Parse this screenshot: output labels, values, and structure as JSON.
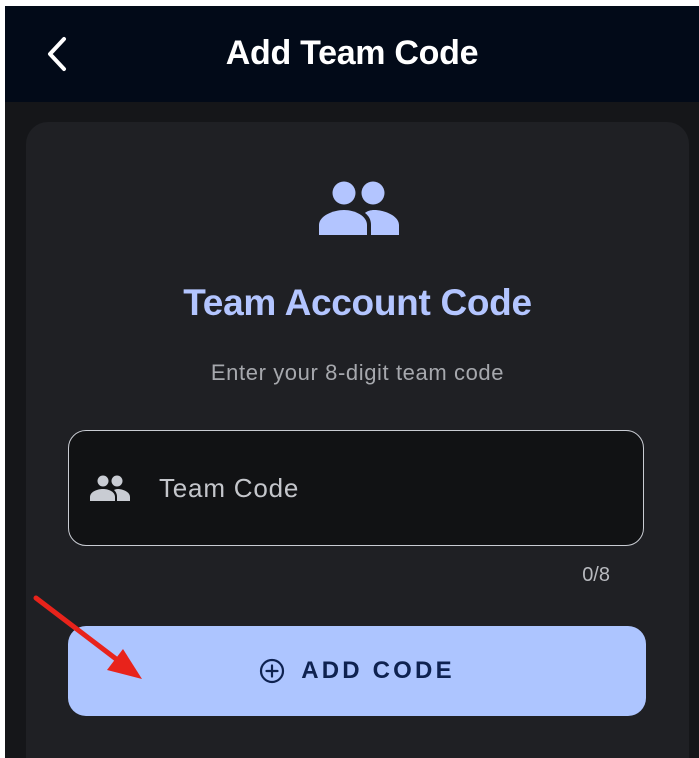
{
  "appbar": {
    "title": "Add Team Code",
    "back_icon": "chevron-left-icon"
  },
  "card": {
    "icon": "group-icon",
    "title": "Team Account Code",
    "subtitle": "Enter your 8-digit team code"
  },
  "code_field": {
    "icon": "group-icon",
    "value": "",
    "placeholder": "Team Code",
    "counter": "0/8"
  },
  "add_button": {
    "icon": "plus-circle-icon",
    "label": "ADD CODE"
  },
  "colors": {
    "appbar_bg": "#020a18",
    "screen_bg": "#151619",
    "card_bg": "#1f2024",
    "accent": "#b3c5ff",
    "button_bg": "#adc5ff",
    "button_text": "#0e2250",
    "annotation_arrow": "#e8231b"
  }
}
